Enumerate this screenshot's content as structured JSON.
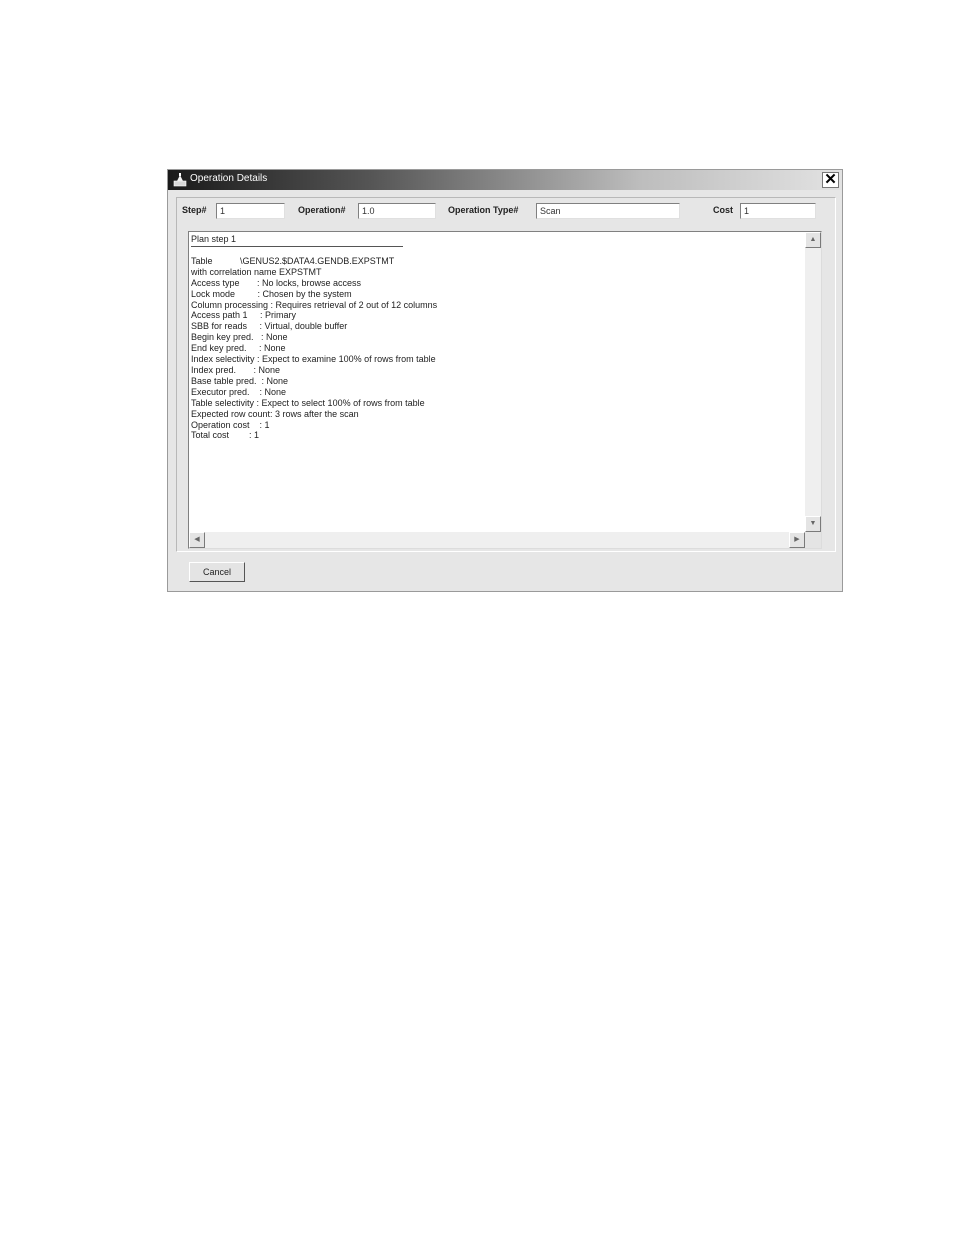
{
  "window": {
    "title": "Operation Details",
    "close_glyph": "✕",
    "close_icon": "close-icon",
    "app_icon": "app-icon"
  },
  "fields": {
    "step": {
      "label": "Step#",
      "value": "1"
    },
    "operation": {
      "label": "Operation#",
      "value": "1.0"
    },
    "operation_type": {
      "label": "Operation Type#",
      "value": "Scan"
    },
    "cost": {
      "label": "Cost",
      "value": "1"
    }
  },
  "plan": {
    "heading": "Plan step 1",
    "lines": [
      "Table           \\GENUS2.$DATA4.GENDB.EXPSTMT",
      "with correlation name EXPSTMT",
      "Access type       : No locks, browse access",
      "Lock mode         : Chosen by the system",
      "Column processing : Requires retrieval of 2 out of 12 columns",
      "Access path 1     : Primary",
      "SBB for reads     : Virtual, double buffer",
      "Begin key pred.   : None",
      "End key pred.     : None",
      "Index selectivity : Expect to examine 100% of rows from table",
      "Index pred.       : None",
      "Base table pred.  : None",
      "Executor pred.    : None",
      "Table selectivity : Expect to select 100% of rows from table",
      "Expected row count: 3 rows after the scan",
      "Operation cost    : 1",
      "Total cost        : 1"
    ]
  },
  "scrollbars": {
    "up_arrow": "▲",
    "down_arrow": "▼",
    "left_arrow": "◀",
    "right_arrow": "▶"
  },
  "buttons": {
    "cancel_label": "Cancel"
  },
  "colors": {
    "dialog_bg": "#e6e6e6",
    "title_text": "#ffffff"
  }
}
